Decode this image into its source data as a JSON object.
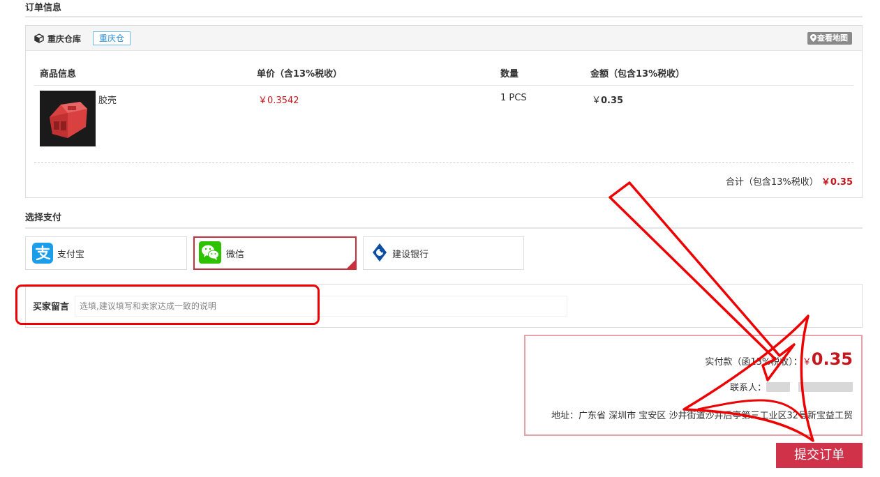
{
  "order_section": {
    "title": "订单信息"
  },
  "warehouse": {
    "name": "重庆仓库",
    "tag": "重庆仓",
    "map_button": "查看地图",
    "columns": [
      "商品信息",
      "单价（含13%税收）",
      "数量",
      "金额（包含13%税收）"
    ],
    "items": [
      {
        "name": "胶壳",
        "unit_price": "￥0.3542",
        "quantity": "1 PCS",
        "amount_symbol": "￥",
        "amount": "0.35"
      }
    ],
    "total_label": "合计（包含13%税收）",
    "total_value": "￥0.35"
  },
  "payment": {
    "title": "选择支付",
    "options": [
      {
        "label": "支付宝",
        "icon": "alipay-icon",
        "selected": false
      },
      {
        "label": "微信",
        "icon": "wechat-icon",
        "selected": true
      },
      {
        "label": "建设银行",
        "icon": "ccb-icon",
        "selected": false
      }
    ]
  },
  "message": {
    "label": "买家留言",
    "placeholder": "选填,建议填写和卖家达成一致的说明"
  },
  "summary": {
    "pay_label": "实付款（函13%税收）：",
    "currency": "￥",
    "amount": "0.35",
    "contact_label": "联系人：",
    "address": "地址：广东省 深圳市 宝安区 沙井街道沙井后亭第三工业区32号新宝益工贸"
  },
  "submit_label": "提交订单",
  "colors": {
    "accent_red": "#c4161c",
    "submit_bg": "#d0324a",
    "link_blue": "#2a8ed3"
  }
}
